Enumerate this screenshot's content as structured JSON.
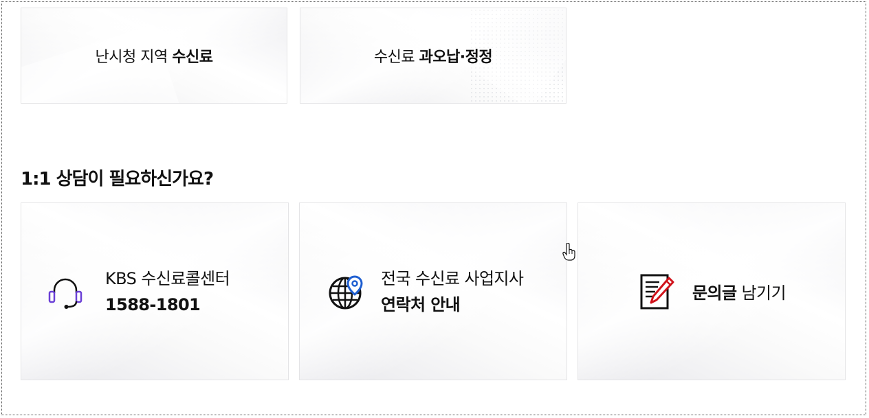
{
  "top_cards": [
    {
      "normal": "난시청 지역 ",
      "bold": "수신료"
    },
    {
      "normal": "수신료 ",
      "bold": "과오납·정정"
    }
  ],
  "consult": {
    "title": "1:1 상담이 필요하신가요?",
    "cards": [
      {
        "line1": "KBS 수신료콜센터",
        "line2": "1588-1801",
        "icon": "headset-icon",
        "icon_color": "#6a3fd6"
      },
      {
        "line1": "전국 수신료 사업지사",
        "line2": "연락처 안내",
        "icon": "globe-location-icon",
        "icon_color": "#1f5fd1"
      },
      {
        "bold": "문의글",
        "normal": " 남기기",
        "icon": "document-pencil-icon",
        "icon_color": "#d0131b"
      }
    ]
  }
}
